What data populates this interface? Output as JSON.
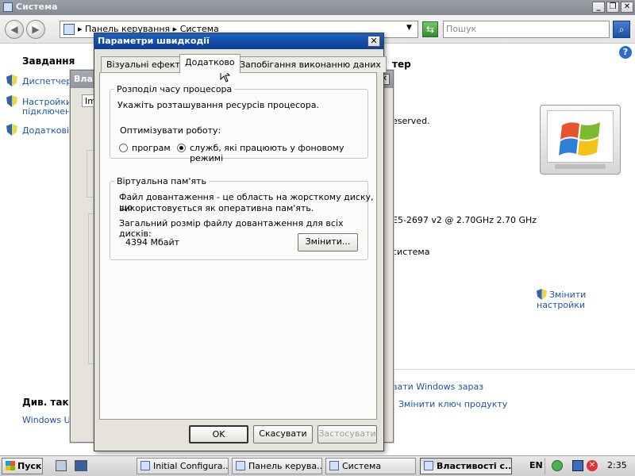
{
  "window": {
    "title": "Система"
  },
  "address": {
    "path_root": "Панель керування",
    "path_leaf": "Система",
    "sep": "▸"
  },
  "search": {
    "placeholder": "Пошук"
  },
  "left": {
    "heading": "Завдання",
    "tasks": [
      "Диспетчер п",
      "Настройки в",
      "підключення",
      "Додаткові н"
    ],
    "see_also": "Див. також",
    "windows_update": "Windows Upd"
  },
  "background": {
    "col_header": "тер",
    "reserved": "eserved.",
    "cpu": "E5-2697 v2 @ 2.70GHz   2.70 GHz",
    "system": "система",
    "change_settings": "Змінити настройки",
    "activate": "вати Windows зараз",
    "change_key": "Змінити ключ продукту",
    "back_dialog_title": "Вла",
    "back_dialog_tab": "Im"
  },
  "dialog": {
    "title": "Параметри швидкодії",
    "tabs": [
      "Візуальні ефекти",
      "Додатково",
      "Запобігання виконанню даних"
    ],
    "cpu_group": {
      "label": "Розподіл часу процесора",
      "desc": "Укажіть розташування ресурсів процесора.",
      "optimize_label": "Оптимізувати роботу:",
      "opt_programs": "програм",
      "opt_services": "служб, які працюють у фоновому режимі",
      "selected": "services"
    },
    "vm_group": {
      "label": "Віртуальна пам'ять",
      "desc_line1": "Файл довантаження - це область на жорсткому диску, що",
      "desc_line2": "використовується як оперативна пам'ять.",
      "total_label": "Загальний розмір файлу довантаження для всіх дисків:",
      "total_value": "4394 Мбайт",
      "change_button": "Змінити..."
    },
    "buttons": {
      "ok": "OK",
      "cancel": "Скасувати",
      "apply": "Застосувати"
    }
  },
  "taskbar": {
    "start": "Пуск",
    "items": [
      "Initial Configura...",
      "Панель керува...",
      "Система",
      "Властивості с..."
    ],
    "lang": "EN",
    "clock": "2:35"
  }
}
